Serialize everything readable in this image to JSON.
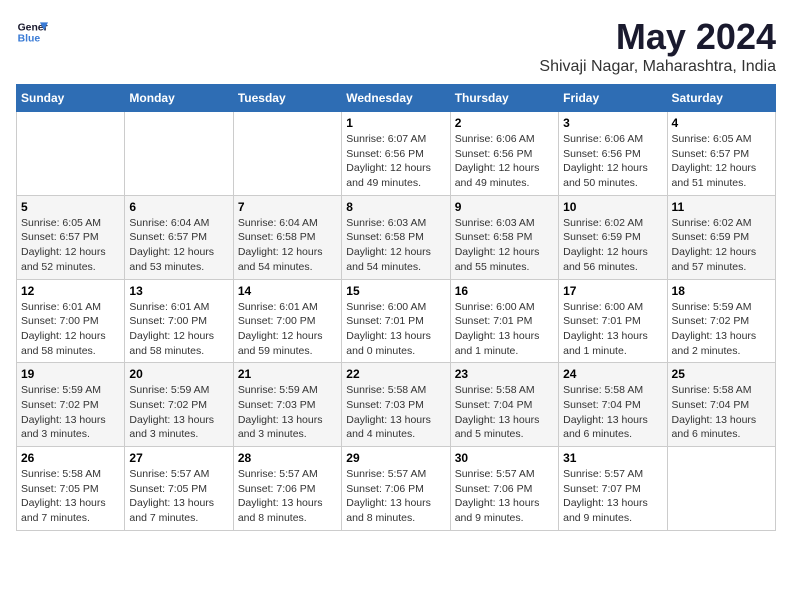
{
  "header": {
    "logo_line1": "General",
    "logo_line2": "Blue",
    "title": "May 2024",
    "subtitle": "Shivaji Nagar, Maharashtra, India"
  },
  "weekdays": [
    "Sunday",
    "Monday",
    "Tuesday",
    "Wednesday",
    "Thursday",
    "Friday",
    "Saturday"
  ],
  "weeks": [
    [
      {
        "day": "",
        "info": ""
      },
      {
        "day": "",
        "info": ""
      },
      {
        "day": "",
        "info": ""
      },
      {
        "day": "1",
        "info": "Sunrise: 6:07 AM\nSunset: 6:56 PM\nDaylight: 12 hours\nand 49 minutes."
      },
      {
        "day": "2",
        "info": "Sunrise: 6:06 AM\nSunset: 6:56 PM\nDaylight: 12 hours\nand 49 minutes."
      },
      {
        "day": "3",
        "info": "Sunrise: 6:06 AM\nSunset: 6:56 PM\nDaylight: 12 hours\nand 50 minutes."
      },
      {
        "day": "4",
        "info": "Sunrise: 6:05 AM\nSunset: 6:57 PM\nDaylight: 12 hours\nand 51 minutes."
      }
    ],
    [
      {
        "day": "5",
        "info": "Sunrise: 6:05 AM\nSunset: 6:57 PM\nDaylight: 12 hours\nand 52 minutes."
      },
      {
        "day": "6",
        "info": "Sunrise: 6:04 AM\nSunset: 6:57 PM\nDaylight: 12 hours\nand 53 minutes."
      },
      {
        "day": "7",
        "info": "Sunrise: 6:04 AM\nSunset: 6:58 PM\nDaylight: 12 hours\nand 54 minutes."
      },
      {
        "day": "8",
        "info": "Sunrise: 6:03 AM\nSunset: 6:58 PM\nDaylight: 12 hours\nand 54 minutes."
      },
      {
        "day": "9",
        "info": "Sunrise: 6:03 AM\nSunset: 6:58 PM\nDaylight: 12 hours\nand 55 minutes."
      },
      {
        "day": "10",
        "info": "Sunrise: 6:02 AM\nSunset: 6:59 PM\nDaylight: 12 hours\nand 56 minutes."
      },
      {
        "day": "11",
        "info": "Sunrise: 6:02 AM\nSunset: 6:59 PM\nDaylight: 12 hours\nand 57 minutes."
      }
    ],
    [
      {
        "day": "12",
        "info": "Sunrise: 6:01 AM\nSunset: 7:00 PM\nDaylight: 12 hours\nand 58 minutes."
      },
      {
        "day": "13",
        "info": "Sunrise: 6:01 AM\nSunset: 7:00 PM\nDaylight: 12 hours\nand 58 minutes."
      },
      {
        "day": "14",
        "info": "Sunrise: 6:01 AM\nSunset: 7:00 PM\nDaylight: 12 hours\nand 59 minutes."
      },
      {
        "day": "15",
        "info": "Sunrise: 6:00 AM\nSunset: 7:01 PM\nDaylight: 13 hours\nand 0 minutes."
      },
      {
        "day": "16",
        "info": "Sunrise: 6:00 AM\nSunset: 7:01 PM\nDaylight: 13 hours\nand 1 minute."
      },
      {
        "day": "17",
        "info": "Sunrise: 6:00 AM\nSunset: 7:01 PM\nDaylight: 13 hours\nand 1 minute."
      },
      {
        "day": "18",
        "info": "Sunrise: 5:59 AM\nSunset: 7:02 PM\nDaylight: 13 hours\nand 2 minutes."
      }
    ],
    [
      {
        "day": "19",
        "info": "Sunrise: 5:59 AM\nSunset: 7:02 PM\nDaylight: 13 hours\nand 3 minutes."
      },
      {
        "day": "20",
        "info": "Sunrise: 5:59 AM\nSunset: 7:02 PM\nDaylight: 13 hours\nand 3 minutes."
      },
      {
        "day": "21",
        "info": "Sunrise: 5:59 AM\nSunset: 7:03 PM\nDaylight: 13 hours\nand 3 minutes."
      },
      {
        "day": "22",
        "info": "Sunrise: 5:58 AM\nSunset: 7:03 PM\nDaylight: 13 hours\nand 4 minutes."
      },
      {
        "day": "23",
        "info": "Sunrise: 5:58 AM\nSunset: 7:04 PM\nDaylight: 13 hours\nand 5 minutes."
      },
      {
        "day": "24",
        "info": "Sunrise: 5:58 AM\nSunset: 7:04 PM\nDaylight: 13 hours\nand 6 minutes."
      },
      {
        "day": "25",
        "info": "Sunrise: 5:58 AM\nSunset: 7:04 PM\nDaylight: 13 hours\nand 6 minutes."
      }
    ],
    [
      {
        "day": "26",
        "info": "Sunrise: 5:58 AM\nSunset: 7:05 PM\nDaylight: 13 hours\nand 7 minutes."
      },
      {
        "day": "27",
        "info": "Sunrise: 5:57 AM\nSunset: 7:05 PM\nDaylight: 13 hours\nand 7 minutes."
      },
      {
        "day": "28",
        "info": "Sunrise: 5:57 AM\nSunset: 7:06 PM\nDaylight: 13 hours\nand 8 minutes."
      },
      {
        "day": "29",
        "info": "Sunrise: 5:57 AM\nSunset: 7:06 PM\nDaylight: 13 hours\nand 8 minutes."
      },
      {
        "day": "30",
        "info": "Sunrise: 5:57 AM\nSunset: 7:06 PM\nDaylight: 13 hours\nand 9 minutes."
      },
      {
        "day": "31",
        "info": "Sunrise: 5:57 AM\nSunset: 7:07 PM\nDaylight: 13 hours\nand 9 minutes."
      },
      {
        "day": "",
        "info": ""
      }
    ]
  ]
}
